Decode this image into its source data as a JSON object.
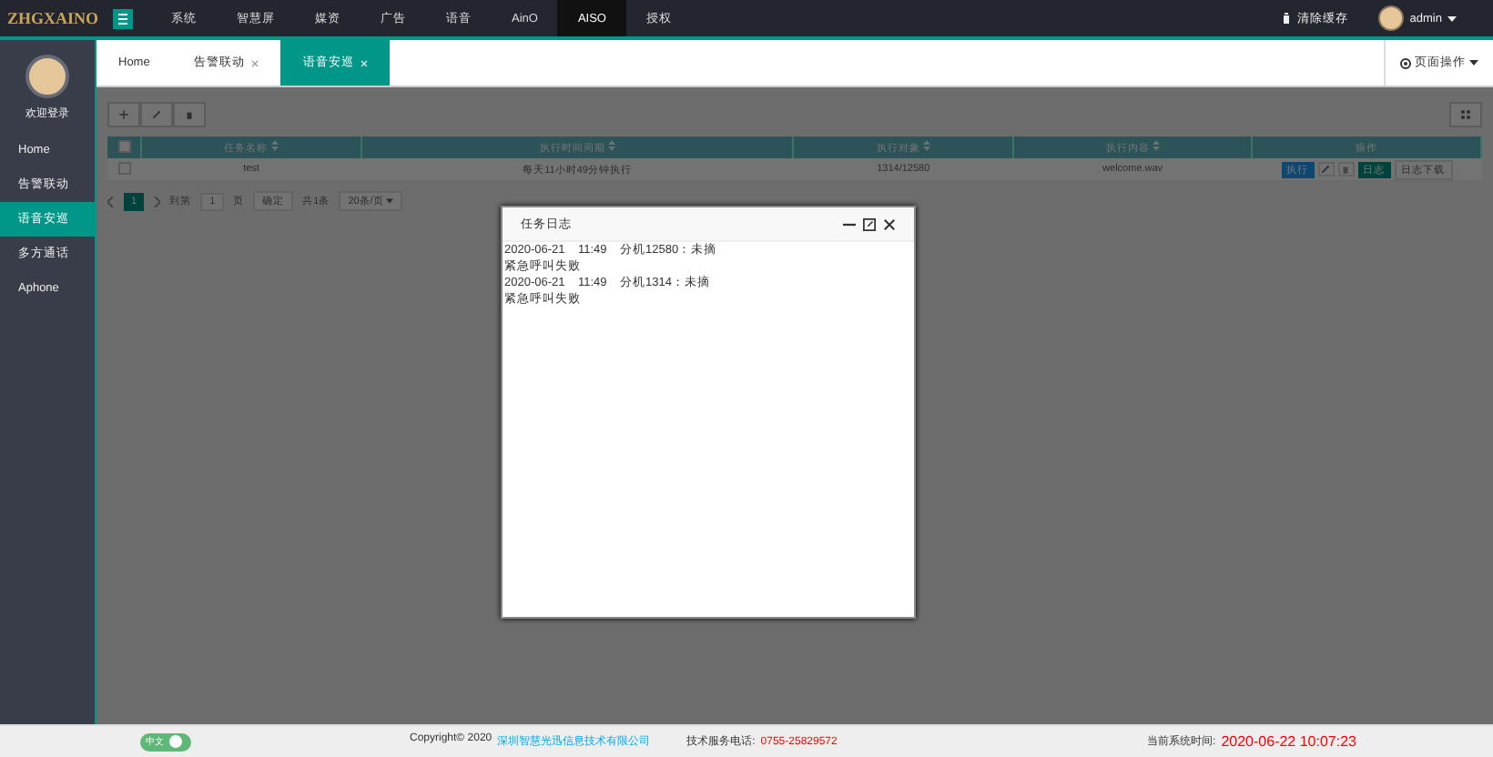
{
  "logo": "ZHGXAINO",
  "top_nav": [
    {
      "label": "系统",
      "selected": false
    },
    {
      "label": "智慧屏",
      "selected": false
    },
    {
      "label": "媒资",
      "selected": false
    },
    {
      "label": "广告",
      "selected": false
    },
    {
      "label": "语音",
      "selected": false
    },
    {
      "label": "AinO",
      "selected": false
    },
    {
      "label": "AISO",
      "selected": true
    },
    {
      "label": "授权",
      "selected": false
    }
  ],
  "header_right": {
    "clear_cache": "清除缓存",
    "user": "admin"
  },
  "sidebar": {
    "welcome": "欢迎登录",
    "items": [
      {
        "label": "Home",
        "selected": false
      },
      {
        "label": "告警联动",
        "selected": false
      },
      {
        "label": "语音安巡",
        "selected": true
      },
      {
        "label": "多方通话",
        "selected": false
      },
      {
        "label": "Aphone",
        "selected": false
      }
    ]
  },
  "tabs": [
    {
      "label": "Home",
      "closable": false,
      "selected": false
    },
    {
      "label": "告警联动",
      "closable": true,
      "selected": false
    },
    {
      "label": "语音安巡",
      "closable": true,
      "selected": true
    }
  ],
  "page_actions": "页面操作",
  "table": {
    "all_checked": false,
    "columns": [
      "任务名称",
      "执行时间周期",
      "执行对象",
      "执行内容",
      "操作"
    ],
    "rows": [
      {
        "checked": false,
        "cells": [
          "test",
          "每天11小时49分钟执行",
          "1314/12580",
          "welcome.wav"
        ],
        "actions": {
          "run": "执行",
          "log": "日志",
          "download": "日志下载"
        }
      }
    ]
  },
  "pagination": {
    "current": "1",
    "goto": "到第",
    "page_input": "1",
    "page_unit": "页",
    "confirm": "确定",
    "total": "共1条",
    "page_size": "20条/页"
  },
  "dialog": {
    "title": "任务日志",
    "lines": [
      "2020-06-21    11:49    分机12580：未摘",
      "紧急呼叫失败",
      "2020-06-21    11:49    分机1314：未摘",
      "紧急呼叫失败"
    ]
  },
  "footer": {
    "language": "中文",
    "language_on": true,
    "copyright": "Copyright© 2020",
    "company": "深圳智慧光迅信息技术有限公司",
    "phone_label": "技术服务电话:",
    "phone": "0755-25829572",
    "time_label": "当前系统时间:",
    "time": "2020-06-22 10:07:23"
  }
}
